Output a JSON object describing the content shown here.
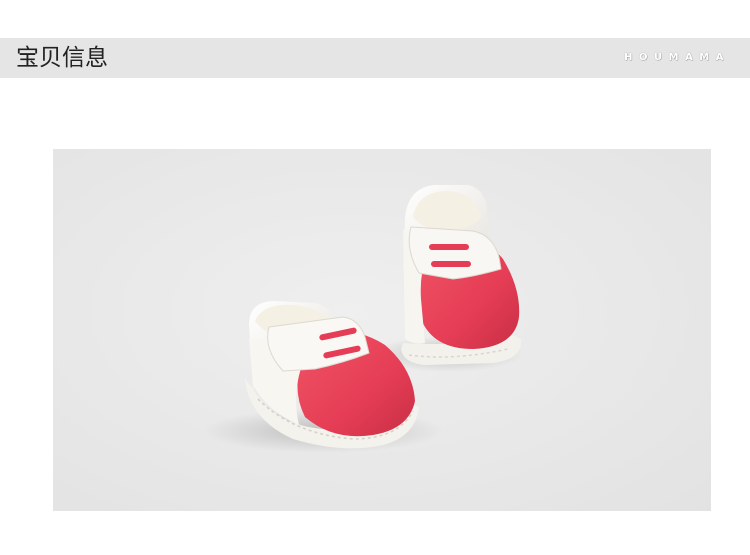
{
  "header": {
    "title": "宝贝信息",
    "brand": "HOUMAMA"
  },
  "photo": {
    "subject": "baby-shoes-pair",
    "colors": {
      "background": "#e9e9e9",
      "shoe_white": "#f6f4ef",
      "shoe_red": "#e9435a",
      "lining": "#f2eee3"
    }
  }
}
